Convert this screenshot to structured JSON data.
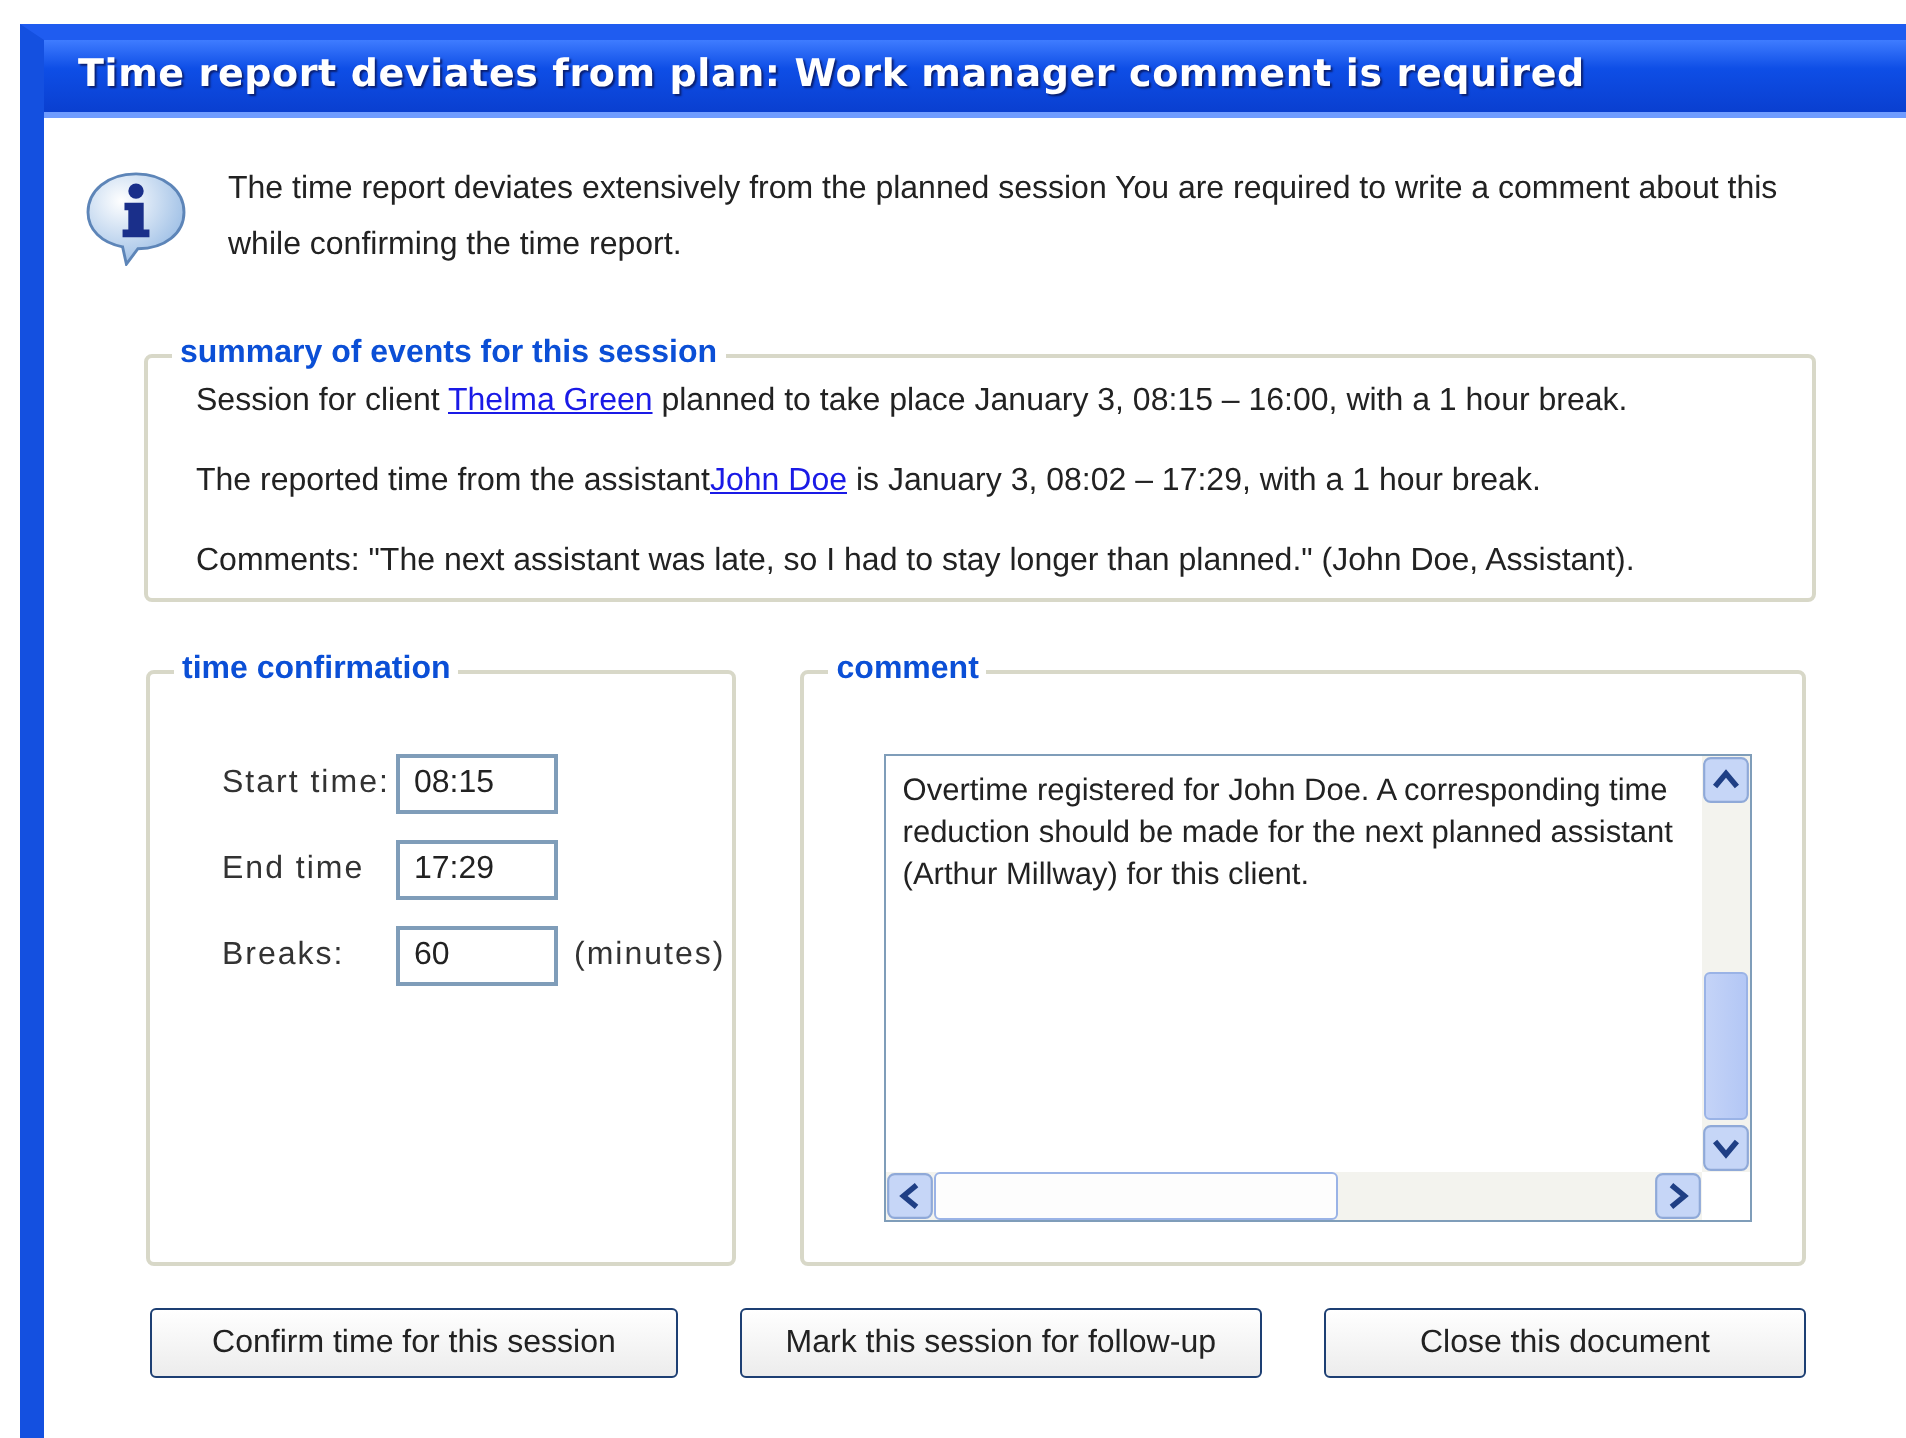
{
  "window": {
    "title": "Time report deviates from plan: Work manager comment is required"
  },
  "notice": "The time report deviates extensively from the planned session You are required to write a comment about this while confirming the time report.",
  "summary": {
    "legend": "summary of events for this session",
    "lines": [
      {
        "before": "Session for client ",
        "link": "Thelma Green",
        "after": " planned to take place January 3, 08:15 – 16:00, with a 1 hour break."
      },
      {
        "before": "The reported time from the assistant",
        "link": "John Doe",
        "after": " is January 3, 08:02 – 17:29, with a 1 hour break."
      },
      {
        "before": "Comments: \"The next assistant was late, so I had to stay longer than planned.\" (John Doe, Assistant)."
      }
    ]
  },
  "time_confirmation": {
    "legend": "time confirmation",
    "fields": [
      {
        "label": "Start time:",
        "value": "08:15"
      },
      {
        "label": "End time",
        "value": "17:29"
      },
      {
        "label": "Breaks:",
        "value": "60",
        "unit": "(minutes)"
      }
    ]
  },
  "comment": {
    "legend": "comment",
    "value": "Overtime registered for John Doe. A corresponding time reduction should be made for the next planned assistant (Arthur Millway) for this client."
  },
  "buttons": [
    "Confirm time for this session",
    "Mark this session for follow-up",
    "Close this document"
  ]
}
